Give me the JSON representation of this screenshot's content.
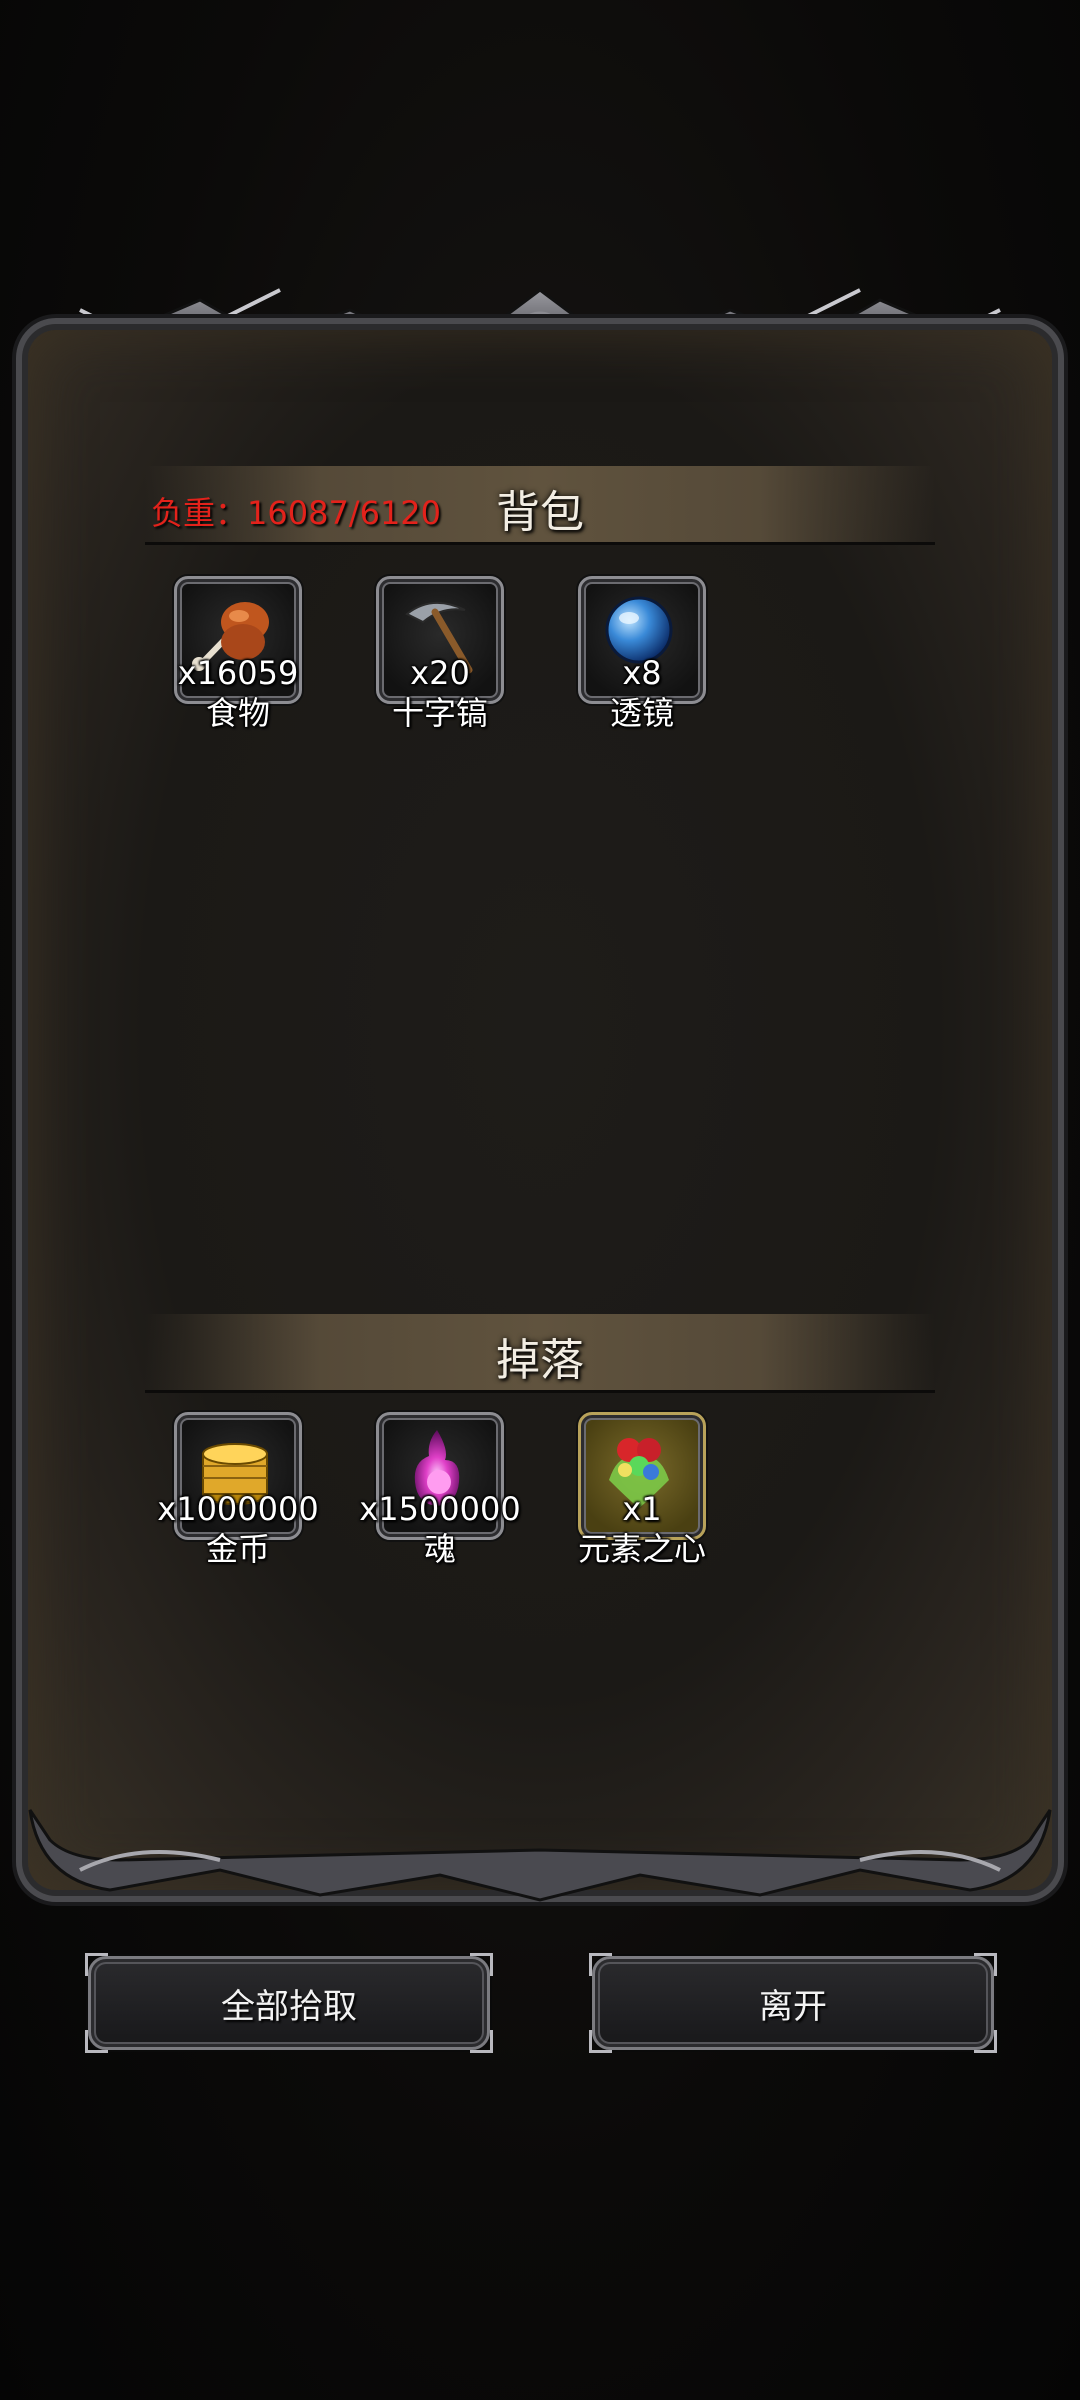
{
  "backpack": {
    "title": "背包",
    "weight_text": "负重：16087/6120",
    "items": [
      {
        "count": "x16059",
        "name": "食物",
        "icon": "meat-icon"
      },
      {
        "count": "x20",
        "name": "十字镐",
        "icon": "pickaxe-icon"
      },
      {
        "count": "x8",
        "name": "透镜",
        "icon": "lens-icon"
      }
    ]
  },
  "drops": {
    "title": "掉落",
    "items": [
      {
        "count": "x1000000",
        "name": "金币",
        "icon": "gold-coins-icon"
      },
      {
        "count": "x1500000",
        "name": "魂",
        "icon": "soul-flame-icon"
      },
      {
        "count": "x1",
        "name": "元素之心",
        "icon": "element-heart-icon"
      }
    ]
  },
  "buttons": {
    "pick_all": "全部拾取",
    "leave": "离开"
  },
  "colors": {
    "weight_red": "#e3221b",
    "header_band": "#60533e",
    "panel_bg": "#1b1916"
  }
}
